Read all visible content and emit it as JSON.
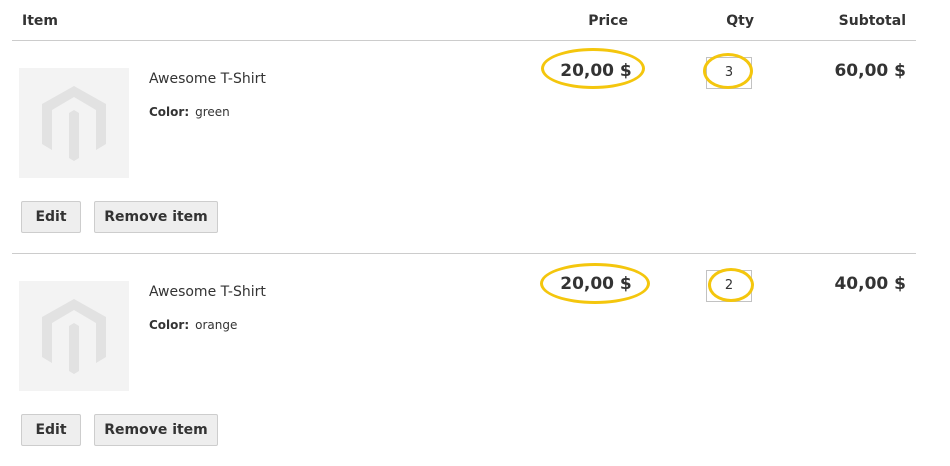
{
  "header": {
    "item": "Item",
    "price": "Price",
    "qty": "Qty",
    "subtotal": "Subtotal"
  },
  "items": [
    {
      "name": "Awesome T-Shirt",
      "option_label": "Color:",
      "option_value": "green",
      "price": "20,00 $",
      "qty": "3",
      "subtotal": "60,00 $",
      "edit_label": "Edit",
      "remove_label": "Remove item"
    },
    {
      "name": "Awesome T-Shirt",
      "option_label": "Color:",
      "option_value": "orange",
      "price": "20,00 $",
      "qty": "2",
      "subtotal": "40,00 $",
      "edit_label": "Edit",
      "remove_label": "Remove item"
    }
  ],
  "colors": {
    "highlight": "#f4c60d",
    "placeholder_bg": "#f3f3f3",
    "button_bg": "#eeeeee",
    "divider": "#cccccc"
  },
  "icons": {
    "product_placeholder": "magento-logo-placeholder-icon"
  }
}
